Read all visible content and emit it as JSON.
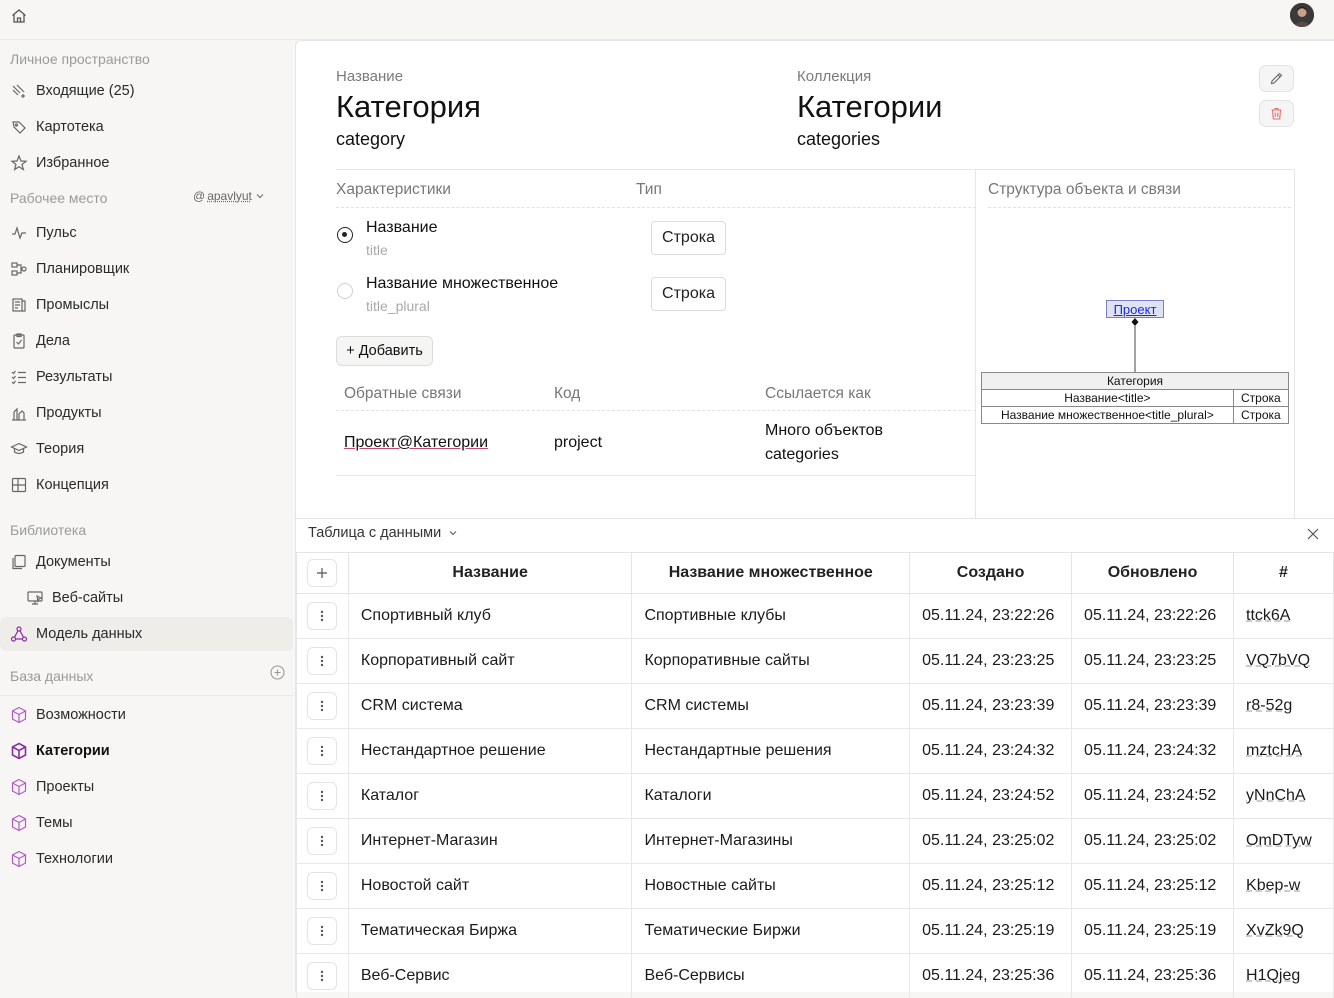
{
  "sidebar": {
    "personal_heading": "Личное пространство",
    "personal_items": [
      {
        "label": "Входящие (25)",
        "icon": "inbox-icon"
      },
      {
        "label": "Картотека",
        "icon": "tag-icon"
      },
      {
        "label": "Избранное",
        "icon": "star-icon"
      }
    ],
    "workspace_heading": "Рабочее место",
    "workspace_user": "apavlyut",
    "workspace_items": [
      {
        "label": "Пульс",
        "icon": "pulse-icon"
      },
      {
        "label": "Планировщик",
        "icon": "planner-icon"
      },
      {
        "label": "Промыслы",
        "icon": "crafts-icon"
      },
      {
        "label": "Дела",
        "icon": "clipboard-icon"
      },
      {
        "label": "Результаты",
        "icon": "checklist-icon"
      },
      {
        "label": "Продукты",
        "icon": "products-icon"
      },
      {
        "label": "Теория",
        "icon": "graduation-icon"
      },
      {
        "label": "Концепция",
        "icon": "layout-icon"
      }
    ],
    "library_heading": "Библиотека",
    "library_items": [
      {
        "label": "Документы",
        "icon": "documents-icon"
      },
      {
        "label": "Веб-сайты",
        "icon": "website-icon"
      },
      {
        "label": "Модель данных",
        "icon": "data-model-icon"
      }
    ],
    "database_heading": "База данных",
    "database_items": [
      {
        "label": "Возможности",
        "icon": "cube-icon"
      },
      {
        "label": "Категории",
        "icon": "cube-icon"
      },
      {
        "label": "Проекты",
        "icon": "cube-icon"
      },
      {
        "label": "Темы",
        "icon": "cube-icon"
      },
      {
        "label": "Технологии",
        "icon": "cube-icon"
      }
    ]
  },
  "entity": {
    "name_label": "Название",
    "name": "Категория",
    "code": "category",
    "collection_label": "Коллекция",
    "collection": "Категории",
    "collection_code": "categories"
  },
  "properties": {
    "col_name": "Характеристики",
    "col_type": "Тип",
    "items": [
      {
        "name": "Название",
        "code": "title",
        "type": "Строка"
      },
      {
        "name": "Название множественное",
        "code": "title_plural",
        "type": "Строка"
      }
    ],
    "add_label": "+ Добавить"
  },
  "relations": {
    "col_back": "Обратные связи",
    "col_code": "Код",
    "col_ref": "Ссылается как",
    "items": [
      {
        "link": "Проект@Категории",
        "code": "project",
        "ref_line1": "Много объектов",
        "ref_line2": "categories"
      }
    ]
  },
  "structure": {
    "title": "Структура объекта и связи",
    "link": "Проект",
    "entity": "Категория",
    "rows": [
      {
        "field": "Название<title>",
        "type": "Строка"
      },
      {
        "field": "Название множественное<title_plural>",
        "type": "Строка"
      }
    ]
  },
  "data_table": {
    "title": "Таблица с данными",
    "columns": [
      "Название",
      "Название множественное",
      "Создано",
      "Обновлено",
      "#"
    ],
    "rows": [
      [
        "Спортивный клуб",
        "Спортивные клубы",
        "05.11.24, 23:22:26",
        "05.11.24, 23:22:26",
        "ttck6A"
      ],
      [
        "Корпоративный сайт",
        "Корпоративные сайты",
        "05.11.24, 23:23:25",
        "05.11.24, 23:23:25",
        "VQ7bVQ"
      ],
      [
        "CRM система",
        "CRM системы",
        "05.11.24, 23:23:39",
        "05.11.24, 23:23:39",
        "r8-52g"
      ],
      [
        "Нестандартное решение",
        "Нестандартные решения",
        "05.11.24, 23:24:32",
        "05.11.24, 23:24:32",
        "mztcHA"
      ],
      [
        "Каталог",
        "Каталоги",
        "05.11.24, 23:24:52",
        "05.11.24, 23:24:52",
        "yNnChA"
      ],
      [
        "Интернет-Магазин",
        "Интернет-Магазины",
        "05.11.24, 23:25:02",
        "05.11.24, 23:25:02",
        "OmDTyw"
      ],
      [
        "Новостой сайт",
        "Новостные сайты",
        "05.11.24, 23:25:12",
        "05.11.24, 23:25:12",
        "Kbep-w"
      ],
      [
        "Тематическая Биржа",
        "Тематические Биржи",
        "05.11.24, 23:25:19",
        "05.11.24, 23:25:19",
        "XvZk9Q"
      ],
      [
        "Веб-Сервис",
        "Веб-Сервисы",
        "05.11.24, 23:25:36",
        "05.11.24, 23:25:36",
        "H1Qjeg"
      ]
    ]
  }
}
